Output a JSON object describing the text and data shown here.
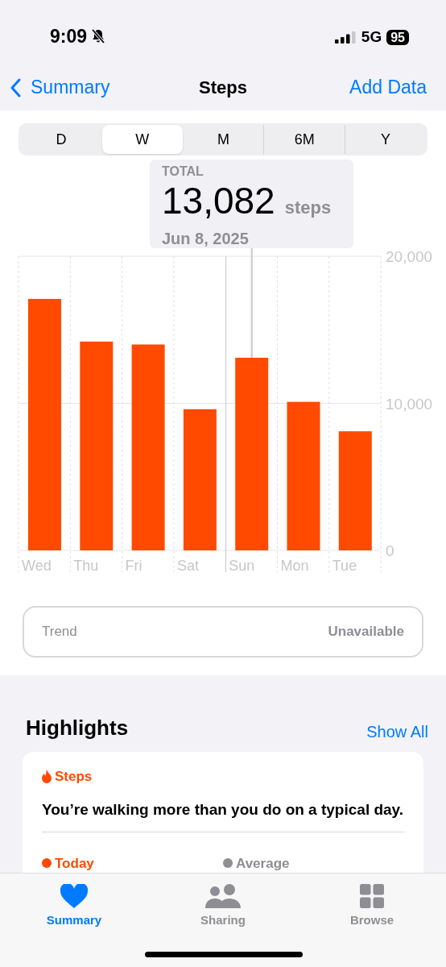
{
  "status_bar": {
    "time": "9:09",
    "network": "5G",
    "battery": "95"
  },
  "nav": {
    "back": "Summary",
    "title": "Steps",
    "action": "Add Data"
  },
  "ranges": [
    {
      "label": "D",
      "selected": false
    },
    {
      "label": "W",
      "selected": true
    },
    {
      "label": "M",
      "selected": false
    },
    {
      "label": "6M",
      "selected": false
    },
    {
      "label": "Y",
      "selected": false
    }
  ],
  "tooltip": {
    "caption": "TOTAL",
    "value": "13,082",
    "unit": "steps",
    "date": "Jun 8, 2025"
  },
  "chart_data": {
    "type": "bar",
    "categories": [
      "Wed",
      "Thu",
      "Fri",
      "Sat",
      "Sun",
      "Mon",
      "Tue"
    ],
    "values": [
      17100,
      14200,
      14000,
      9600,
      13100,
      10100,
      8100
    ],
    "ylim": [
      0,
      20000
    ],
    "yticks": [
      {
        "value": 0,
        "label": "0"
      },
      {
        "value": 10000,
        "label": "10,000"
      },
      {
        "value": 20000,
        "label": "20,000"
      }
    ],
    "annotations": [
      {
        "x": "Sun"
      }
    ]
  },
  "trend": {
    "label": "Trend",
    "value": "Unavailable"
  },
  "highlights": {
    "title": "Highlights",
    "link": "Show All",
    "card": {
      "category": "Steps",
      "text": "You’re walking more than you do on a typical day.",
      "legend": [
        {
          "label": "Today",
          "color": "#ff4a00"
        },
        {
          "label": "Average",
          "color": "#8e8e93"
        }
      ]
    }
  },
  "tab_bar": [
    {
      "label": "Summary",
      "selected": true
    },
    {
      "label": "Sharing",
      "selected": false
    },
    {
      "label": "Browse",
      "selected": false
    }
  ]
}
